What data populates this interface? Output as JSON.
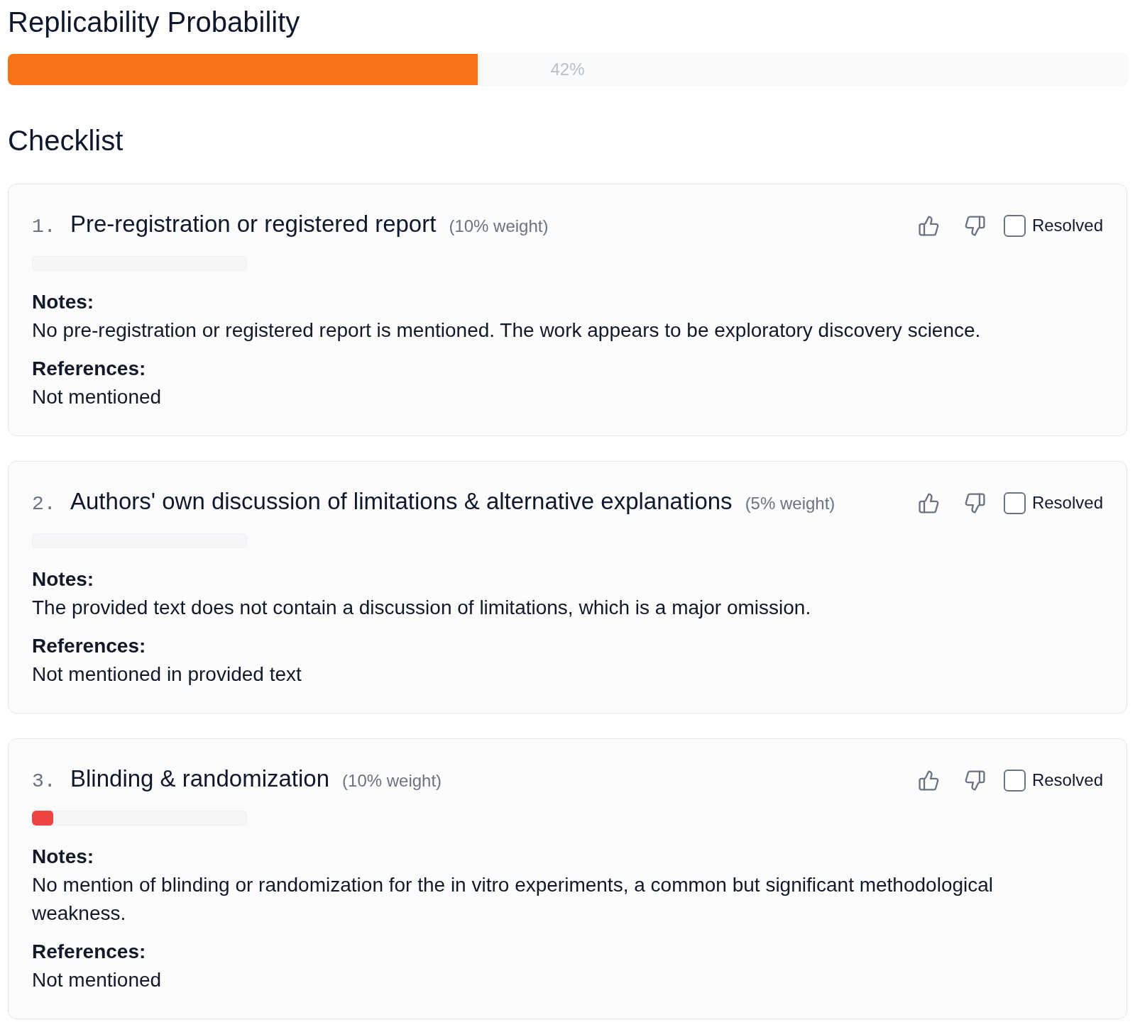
{
  "title": "Replicability Probability",
  "probability": {
    "level": 0.42,
    "reading": "42%"
  },
  "checklist": {
    "heading": "Checklist",
    "items": [
      {
        "number": "1.",
        "title": "Pre-registration or registered report",
        "weight": "(10% weight)",
        "level": 0,
        "resolved": false,
        "resolved_label": "Resolved",
        "notes_label": "Notes:",
        "notes": "No pre-registration or registered report is mentioned. The work appears to be exploratory discovery science.",
        "references_label": "References:",
        "references": "Not mentioned"
      },
      {
        "number": "2.",
        "title": "Authors' own discussion of limitations & alternative explanations",
        "weight": "(5% weight)",
        "level": 0,
        "resolved": false,
        "resolved_label": "Resolved",
        "notes_label": "Notes:",
        "notes": "The provided text does not contain a discussion of limitations, which is a major omission.",
        "references_label": "References:",
        "references": "Not mentioned in provided text"
      },
      {
        "number": "3.",
        "title": "Blinding & randomization",
        "weight": "(10% weight)",
        "level": 0.1,
        "resolved": false,
        "resolved_label": "Resolved",
        "notes_label": "Notes:",
        "notes": "No mention of blinding or randomization for the in vitro experiments, a common but significant methodological weakness.",
        "references_label": "References:",
        "references": "Not mentioned"
      }
    ]
  }
}
